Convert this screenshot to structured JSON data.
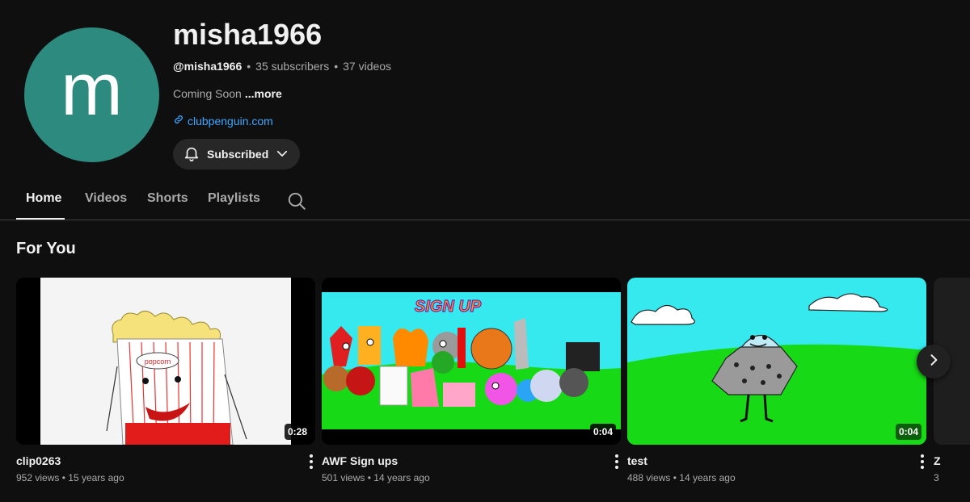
{
  "channel": {
    "avatar_letter": "m",
    "avatar_color": "#2d8a7e",
    "name": "misha1966",
    "handle": "@misha1966",
    "separator": "•",
    "subscribers": "35 subscribers",
    "videos_count": "37 videos",
    "description": "Coming Soon",
    "more_label": "...more",
    "link": "clubpenguin.com",
    "subscribe_label": "Subscribed",
    "icons": {
      "link": "link-icon",
      "bell": "bell-icon",
      "chevron": "chevron-down-icon"
    }
  },
  "tabs": [
    {
      "label": "Home",
      "active": true
    },
    {
      "label": "Videos",
      "active": false
    },
    {
      "label": "Shorts",
      "active": false
    },
    {
      "label": "Playlists",
      "active": false
    }
  ],
  "section": {
    "title": "For You"
  },
  "videos": [
    {
      "title": "clip0263",
      "views": "952 views",
      "age": "15 years ago",
      "duration": "0:28",
      "thumb": "popcorn"
    },
    {
      "title": "AWF Sign ups",
      "views": "501 views",
      "age": "14 years ago",
      "duration": "0:04",
      "thumb": "sign-up",
      "thumb_text": "SIGN UP"
    },
    {
      "title": "test",
      "views": "488 views",
      "age": "14 years ago",
      "duration": "0:04",
      "thumb": "ufo-field"
    }
  ],
  "partial_video": {
    "title": "Z",
    "meta": "3"
  },
  "colors": {
    "background": "#0f0f0f",
    "link": "#3ea6ff",
    "secondary_text": "#aaaaaa"
  }
}
